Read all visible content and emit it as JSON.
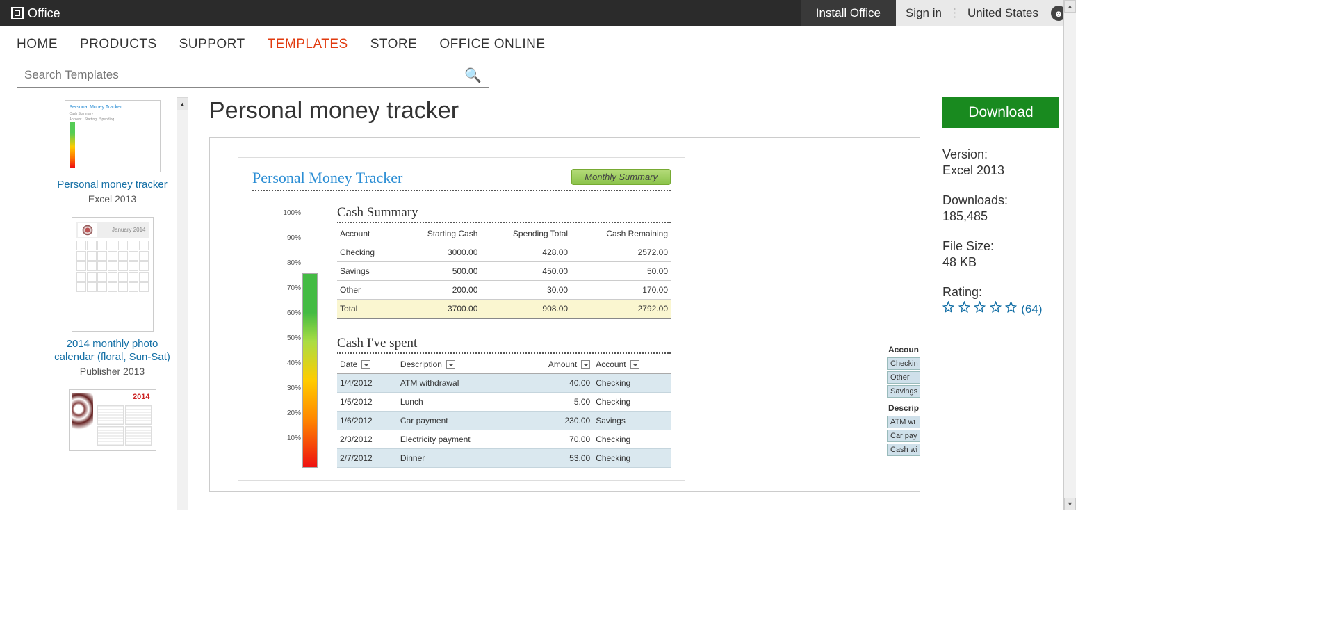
{
  "topbar": {
    "brand": "Office",
    "install": "Install Office",
    "signin": "Sign in",
    "region": "United States"
  },
  "nav": {
    "items": [
      "HOME",
      "PRODUCTS",
      "SUPPORT",
      "TEMPLATES",
      "STORE",
      "OFFICE ONLINE"
    ],
    "active": "TEMPLATES"
  },
  "search": {
    "placeholder": "Search Templates"
  },
  "sidebar": {
    "items": [
      {
        "title": "Personal money tracker",
        "sub": "Excel 2013"
      },
      {
        "title": "2014 monthly photo calendar (floral, Sun-Sat)",
        "sub": "Publisher 2013"
      },
      {
        "title": "",
        "sub": ""
      }
    ],
    "cal_month": "January 2014",
    "cal_year": "2014"
  },
  "page": {
    "title": "Personal money tracker"
  },
  "preview": {
    "title": "Personal Money Tracker",
    "button": "Monthly Summary",
    "gauge_ticks": [
      "100%",
      "90%",
      "80%",
      "70%",
      "60%",
      "50%",
      "40%",
      "30%",
      "20%",
      "10%"
    ],
    "cash_summary": {
      "heading": "Cash Summary",
      "cols": [
        "Account",
        "Starting Cash",
        "Spending Total",
        "Cash Remaining"
      ],
      "rows": [
        [
          "Checking",
          "3000.00",
          "428.00",
          "2572.00"
        ],
        [
          "Savings",
          "500.00",
          "450.00",
          "50.00"
        ],
        [
          "Other",
          "200.00",
          "30.00",
          "170.00"
        ]
      ],
      "total": [
        "Total",
        "3700.00",
        "908.00",
        "2792.00"
      ]
    },
    "cash_spent": {
      "heading": "Cash I've spent",
      "cols": [
        "Date",
        "Description",
        "Amount",
        "Account"
      ],
      "rows": [
        [
          "1/4/2012",
          "ATM withdrawal",
          "40.00",
          "Checking"
        ],
        [
          "1/5/2012",
          "Lunch",
          "5.00",
          "Checking"
        ],
        [
          "1/6/2012",
          "Car payment",
          "230.00",
          "Savings"
        ],
        [
          "2/3/2012",
          "Electricity payment",
          "70.00",
          "Checking"
        ],
        [
          "2/7/2012",
          "Dinner",
          "53.00",
          "Checking"
        ]
      ]
    },
    "slicer": {
      "account_label": "Accoun",
      "accounts": [
        "Checkin",
        "Other",
        "Savings"
      ],
      "desc_label": "Descrip",
      "descs": [
        "ATM wi",
        "Car pay",
        "Cash wi"
      ]
    }
  },
  "details": {
    "download": "Download",
    "version_k": "Version:",
    "version_v": "Excel 2013",
    "downloads_k": "Downloads:",
    "downloads_v": "185,485",
    "size_k": "File Size:",
    "size_v": "48 KB",
    "rating_k": "Rating:",
    "rating_count": "(64)"
  }
}
